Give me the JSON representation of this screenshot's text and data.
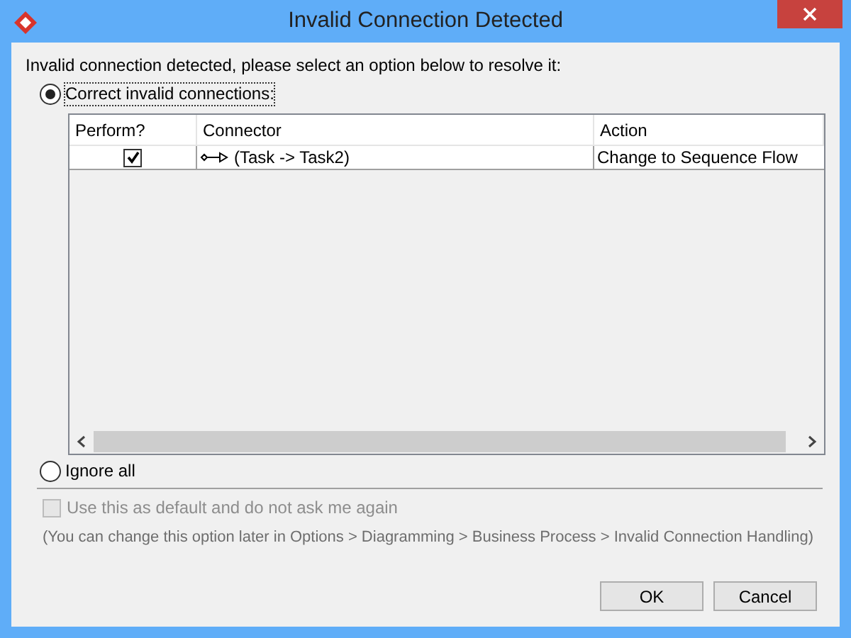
{
  "window": {
    "title": "Invalid Connection Detected"
  },
  "message": "Invalid connection detected, please select an option below to resolve it:",
  "options": [
    {
      "label": "Correct invalid connections:",
      "selected": true
    },
    {
      "label": "Ignore all",
      "selected": false
    }
  ],
  "table": {
    "columns": [
      "Perform?",
      "Connector",
      "Action"
    ],
    "rows": [
      {
        "perform": true,
        "connector": "(Task -> Task2)",
        "action": "Change to Sequence Flow"
      }
    ]
  },
  "default_checkbox": {
    "label": "Use this as default and do not ask me again",
    "checked": false,
    "disabled": true
  },
  "hint": "(You can change this option later in Options > Diagramming > Business Process > Invalid Connection Handling)",
  "buttons": [
    "OK",
    "Cancel"
  ]
}
